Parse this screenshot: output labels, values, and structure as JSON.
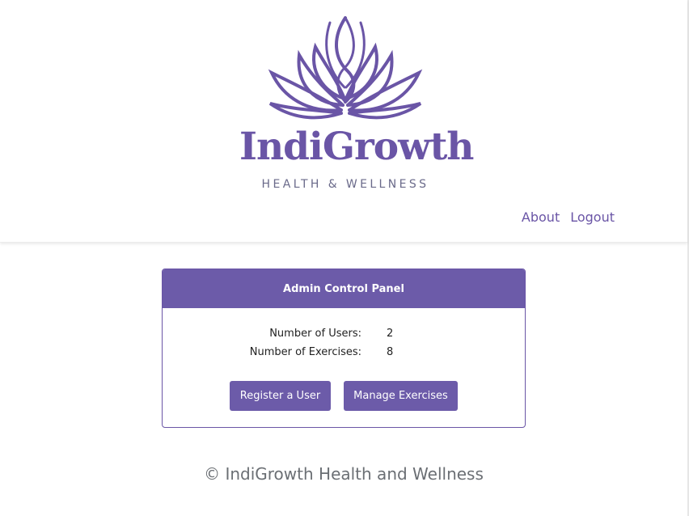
{
  "brand": {
    "name": "IndiGrowth",
    "tagline": "HEALTH & WELLNESS",
    "color": "#6a55a6"
  },
  "nav": {
    "about": "About",
    "logout": "Logout"
  },
  "panel": {
    "title": "Admin Control Panel",
    "stats": [
      {
        "label": "Number of Users:",
        "value": "2"
      },
      {
        "label": "Number of Exercises:",
        "value": "8"
      }
    ],
    "register_label": "Register a User",
    "manage_label": "Manage Exercises",
    "accent": "#6c5ba9"
  },
  "footer": {
    "text": "© IndiGrowth Health and Wellness"
  }
}
